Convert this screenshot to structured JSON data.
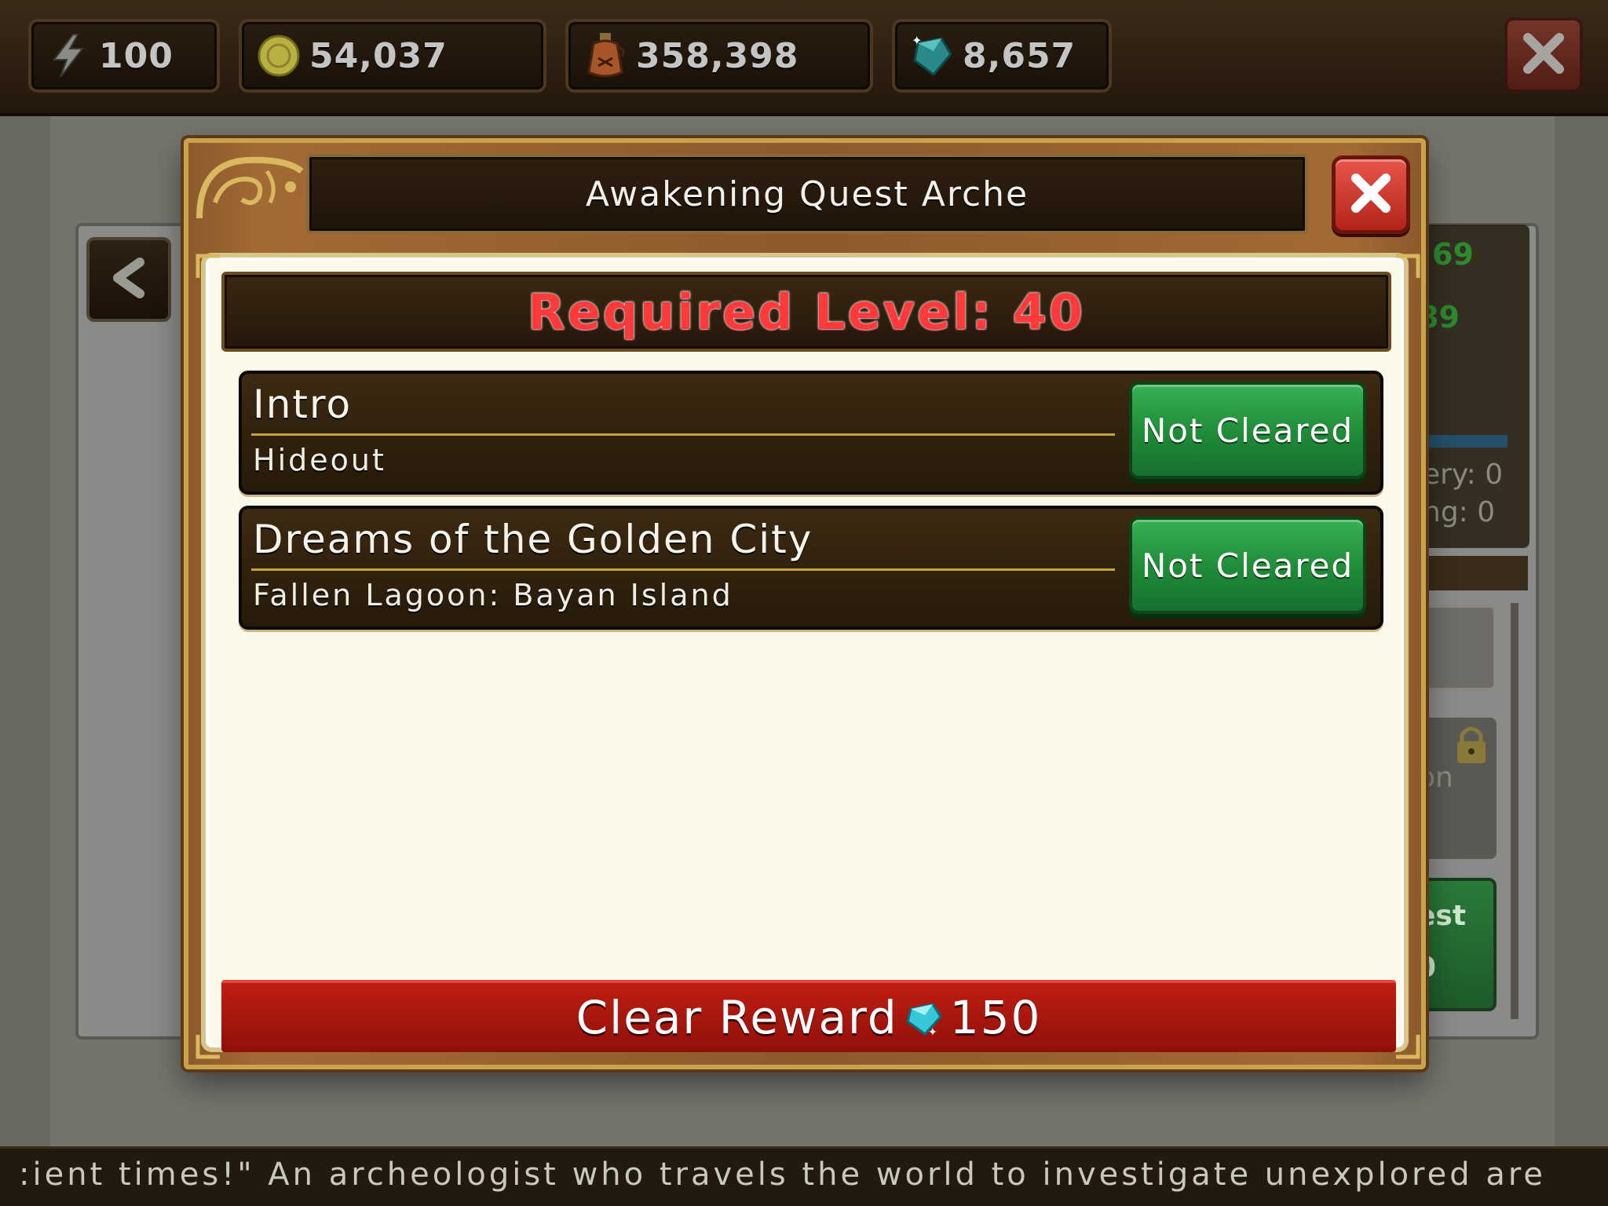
{
  "topbar": {
    "stamina": "100",
    "gold": "54,037",
    "potion": "358,398",
    "gems": "8,657",
    "icons": [
      "lightning-icon",
      "gold-coin-icon",
      "potion-bottle-icon",
      "gem-icon",
      "close-icon"
    ]
  },
  "background": {
    "stats": [
      "69",
      "89"
    ],
    "labels": [
      "ery: 0",
      "ng: 0"
    ],
    "partial_labels": [
      "ion",
      "est",
      "0"
    ]
  },
  "modal": {
    "title": "Awakening Quest Arche",
    "required_level": "Required Level: 40",
    "quests": [
      {
        "title": "Intro",
        "location": "Hideout",
        "status": "Not Cleared"
      },
      {
        "title": "Dreams of the Golden City",
        "location": "Fallen Lagoon: Bayan Island",
        "status": "Not Cleared"
      }
    ],
    "reward": {
      "label": "Clear Reward",
      "amount": "150",
      "icon": "gem-icon"
    }
  },
  "ticker": {
    "text": ":ient times!\"  An archeologist who travels the world to investigate unexplored are"
  },
  "colors": {
    "required_level": "#ff3a3a",
    "status_button": "#1f8a38",
    "reward_bar": "#b0180e",
    "frame_gold": "#c9a24c"
  }
}
